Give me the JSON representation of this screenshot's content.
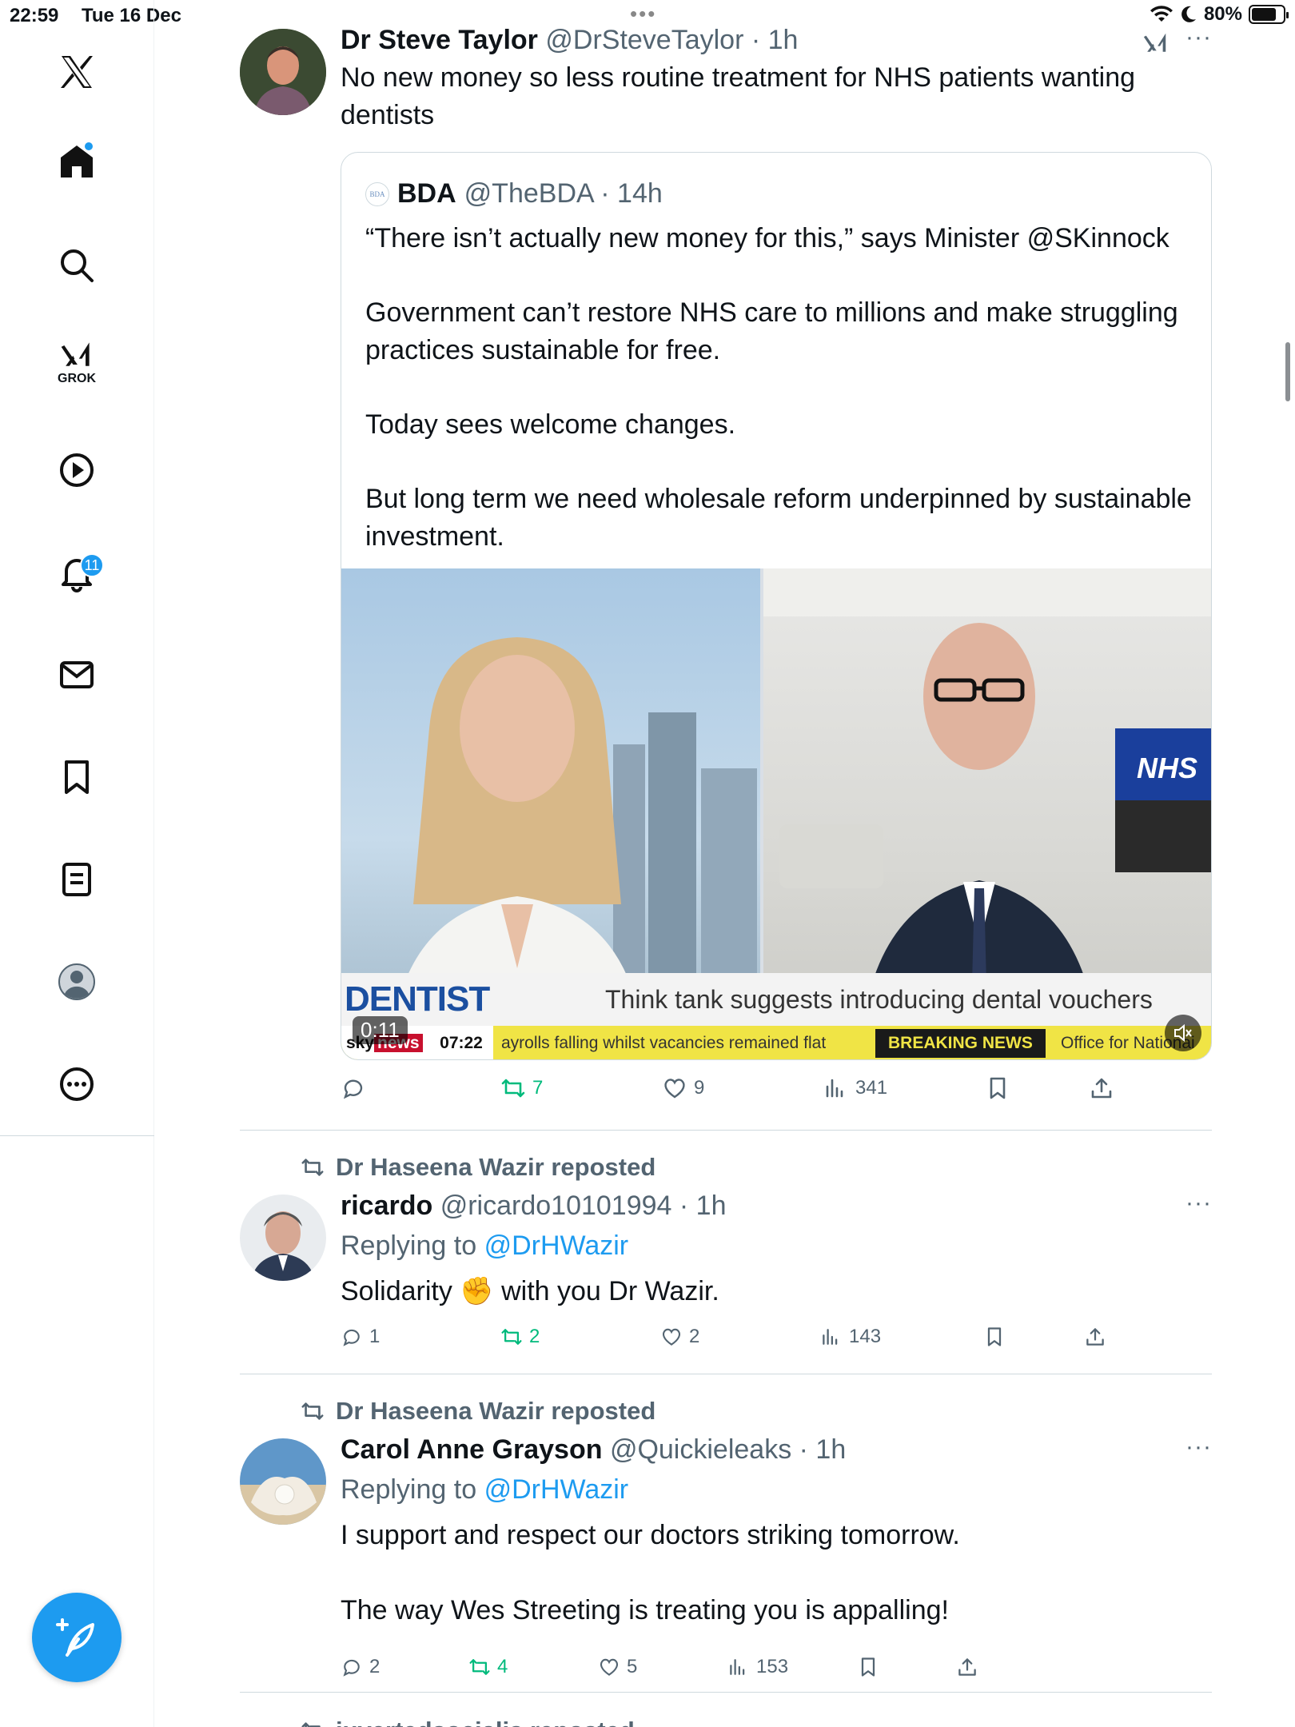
{
  "status_bar": {
    "time": "22:59",
    "date": "Tue 16 Dec",
    "battery": "80%",
    "battery_level": 0.8
  },
  "sidebar": {
    "items": [
      {
        "name": "x-logo"
      },
      {
        "name": "home",
        "has_dot": true
      },
      {
        "name": "search"
      },
      {
        "name": "grok",
        "label": "GROK"
      },
      {
        "name": "video"
      },
      {
        "name": "notifications",
        "badge": "11"
      },
      {
        "name": "messages"
      },
      {
        "name": "bookmarks"
      },
      {
        "name": "lists"
      },
      {
        "name": "profile"
      },
      {
        "name": "more"
      }
    ]
  },
  "colors": {
    "accent": "#1d9bf0",
    "muted": "#536471",
    "repost_green": "#00ba7c",
    "border": "#cfd9de"
  },
  "posts": [
    {
      "name": "Dr Steve Taylor",
      "handle": "@DrSteveTaylor",
      "time": "1h",
      "text": "No new money so less routine treatment for NHS patients wanting dentists",
      "quote": {
        "logo_text": "BDA",
        "name": "BDA",
        "handle": "@TheBDA",
        "time": "14h",
        "paragraphs": [
          "“There isn’t actually new money for this,” says Minister @SKinnock",
          "Government can’t restore NHS care to millions and make struggling practices sustainable for free.",
          "Today sees welcome changes.",
          "But long term we need wholesale reform underpinned by sustainable investment."
        ],
        "video": {
          "banner_title": "DENTIST REFORMS",
          "banner_text": "Think tank suggests introducing dental vouchers",
          "ticker_channel_a": "sky",
          "ticker_channel_b": "news",
          "ticker_clock": "07:22",
          "ticker_text": "ayrolls falling whilst vacancies remained flat",
          "breaking": "BREAKING NEWS",
          "ticker_source": "Office for Nationai",
          "wall_sign": "NHS",
          "duration": "0:11"
        }
      },
      "actions": {
        "replies": "",
        "reposts": "7",
        "likes": "9",
        "views": "341"
      }
    },
    {
      "reposted_by": "Dr Haseena Wazir reposted",
      "name": "ricardo",
      "handle": "@ricardo10101994",
      "time": "1h",
      "replying_prefix": "Replying to",
      "replying_to": "@DrHWazir",
      "text_before": "Solidarity",
      "emoji": "✊",
      "text_after": "with you Dr Wazir.",
      "actions": {
        "replies": "1",
        "reposts": "2",
        "likes": "2",
        "views": "143"
      }
    },
    {
      "reposted_by": "Dr Haseena Wazir reposted",
      "name": "Carol Anne Grayson",
      "handle": "@Quickieleaks",
      "time": "1h",
      "replying_prefix": "Replying to",
      "replying_to": "@DrHWazir",
      "paragraphs": [
        "I support and respect our doctors striking tomorrow.",
        "The way Wes Streeting is treating you is appalling!"
      ],
      "actions": {
        "replies": "2",
        "reposts": "4",
        "likes": "5",
        "views": "153"
      }
    },
    {
      "reposted_by": "juvertedsocialis reposted"
    }
  ]
}
